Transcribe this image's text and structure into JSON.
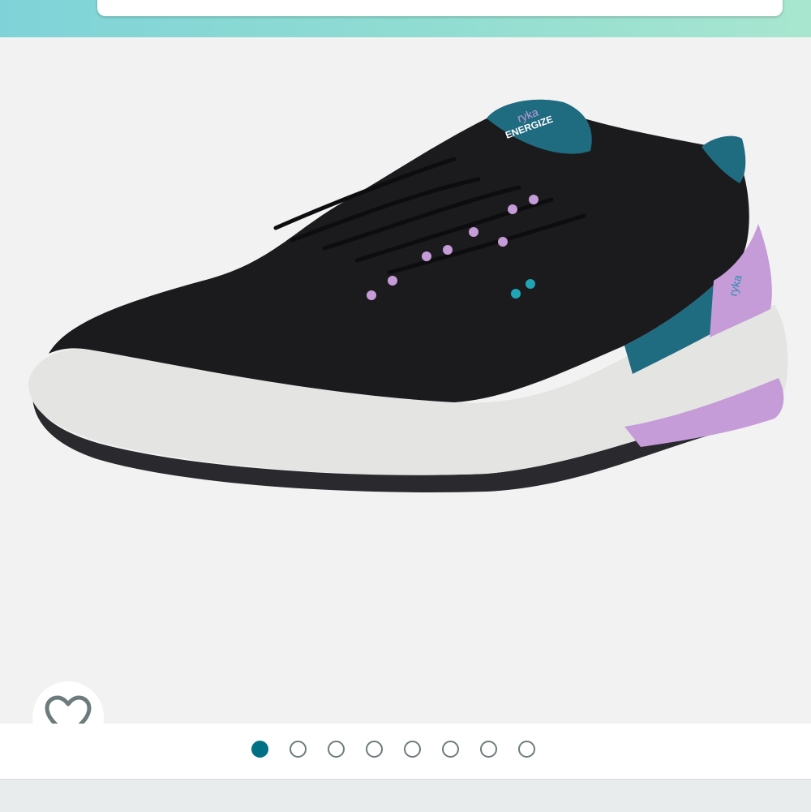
{
  "header": {
    "search_placeholder": ""
  },
  "product_image": {
    "description_icon": "sneaker-image",
    "brand_tongue_text": "ryka",
    "brand_tongue_subtext": "ENERGIZE",
    "heel_text": "ryka"
  },
  "wishlist": {
    "icon": "heart-icon"
  },
  "carousel": {
    "total_images": 8,
    "active_index": 0
  },
  "colors": {
    "accent": "#007185",
    "header_gradient_start": "#7fd3d8",
    "header_gradient_end": "#a8e6cf",
    "shoe_upper": "#1a1a1c",
    "shoe_lavender": "#c59bd8",
    "shoe_teal": "#1f6b80",
    "sole": "#e4e5e3"
  }
}
